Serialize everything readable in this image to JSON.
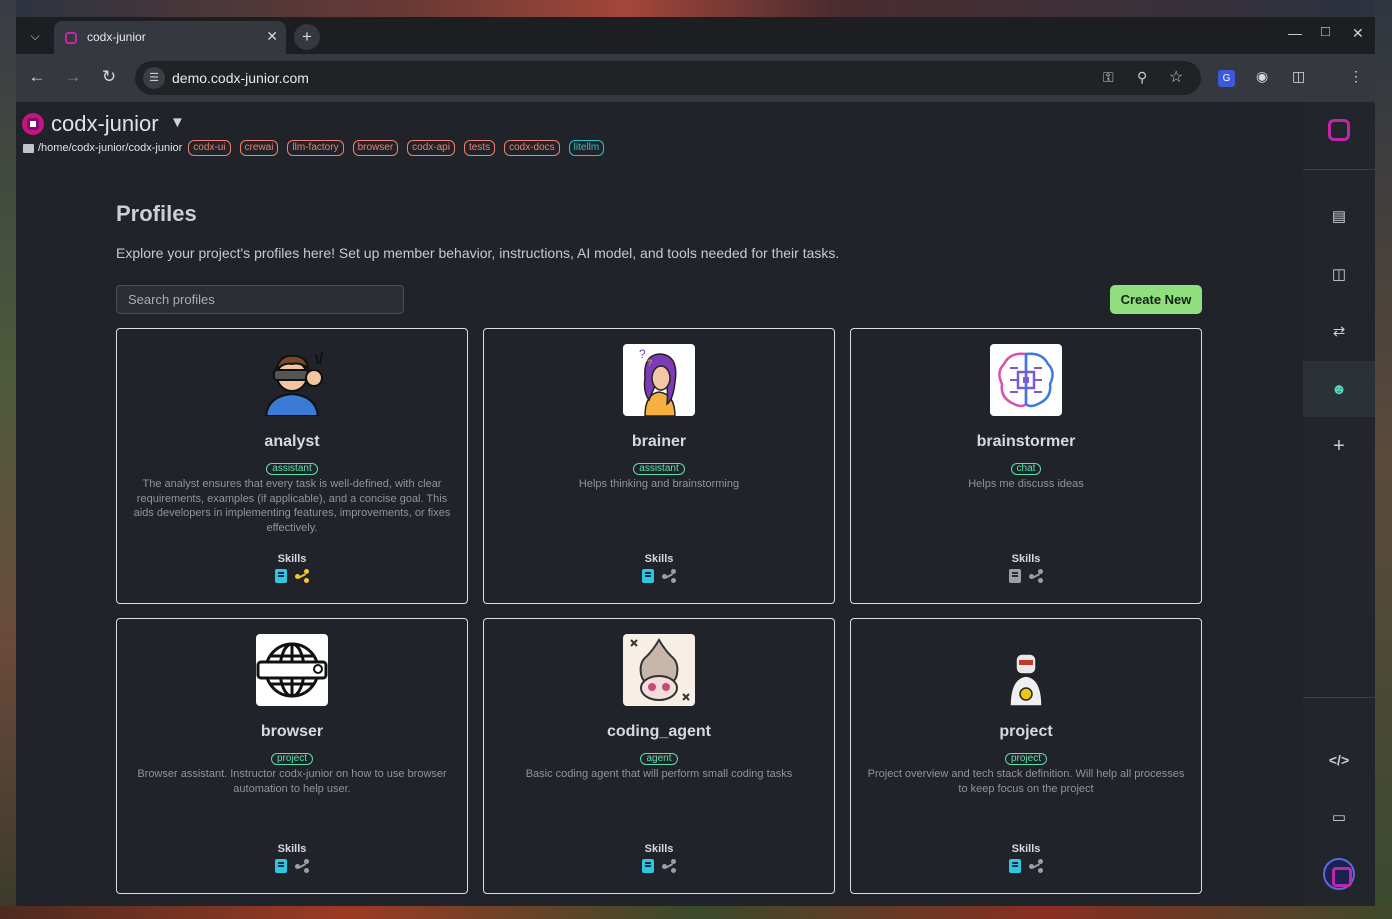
{
  "browser": {
    "tab_title": "codx-junior",
    "url": "demo.codx-junior.com",
    "new_tab_symbol": "+",
    "close_tab_symbol": "✕"
  },
  "app": {
    "project_name": "codx-junior",
    "project_path": "/home/codx-junior/codx-junior",
    "subprojects": [
      {
        "label": "codx-ui",
        "color": "#f08070"
      },
      {
        "label": "crewai",
        "color": "#f08070"
      },
      {
        "label": "llm-factory",
        "color": "#f08070"
      },
      {
        "label": "browser",
        "color": "#f08070"
      },
      {
        "label": "codx-api",
        "color": "#f08070"
      },
      {
        "label": "tests",
        "color": "#f08070"
      },
      {
        "label": "codx-docs",
        "color": "#f08070"
      },
      {
        "label": "litellm",
        "color": "#2bc3c9"
      }
    ]
  },
  "sidebar": {
    "items": [
      {
        "icon": "logo-icon"
      },
      {
        "icon": "book-plus-icon"
      },
      {
        "icon": "kanban-icon"
      },
      {
        "icon": "git-compare-icon"
      },
      {
        "icon": "users-icon",
        "active": true
      },
      {
        "icon": "plus-icon"
      },
      {
        "icon": "code-icon"
      },
      {
        "icon": "monitor-icon"
      },
      {
        "icon": "logo-round-icon"
      }
    ]
  },
  "main": {
    "title": "Profiles",
    "subtitle": "Explore your project's profiles here! Set up member behavior, instructions, AI model, and tools needed for their tasks.",
    "search_placeholder": "Search profiles",
    "create_label": "Create New",
    "skills_label": "Skills",
    "profiles": [
      {
        "name": "analyst",
        "badge": "assistant",
        "description": "The analyst ensures that every task is well-defined, with clear requirements, examples (if applicable), and a concise goal. This aids developers in implementing features, improvements, or fixes effectively.",
        "avatar": "analyst-avatar",
        "share_active": true
      },
      {
        "name": "brainer",
        "badge": "assistant",
        "description": "Helps thinking and brainstorming",
        "avatar": "brainer-avatar",
        "share_active": false
      },
      {
        "name": "brainstormer",
        "badge": "chat",
        "description": "Helps me discuss ideas",
        "avatar": "brainstormer-avatar",
        "share_active": false,
        "book_grey": true
      },
      {
        "name": "browser",
        "badge": "project",
        "description": "Browser assistant. Instructor codx-junior on how to use browser automation to help user.",
        "avatar": "browser-avatar",
        "share_active": false
      },
      {
        "name": "coding_agent",
        "badge": "agent",
        "description": "Basic coding agent that will perform small coding tasks",
        "avatar": "coding-agent-avatar",
        "share_active": false
      },
      {
        "name": "project",
        "badge": "project",
        "description": "Project overview and tech stack definition. Will help all processes to keep focus on the project",
        "avatar": "project-avatar",
        "share_active": false
      }
    ]
  }
}
